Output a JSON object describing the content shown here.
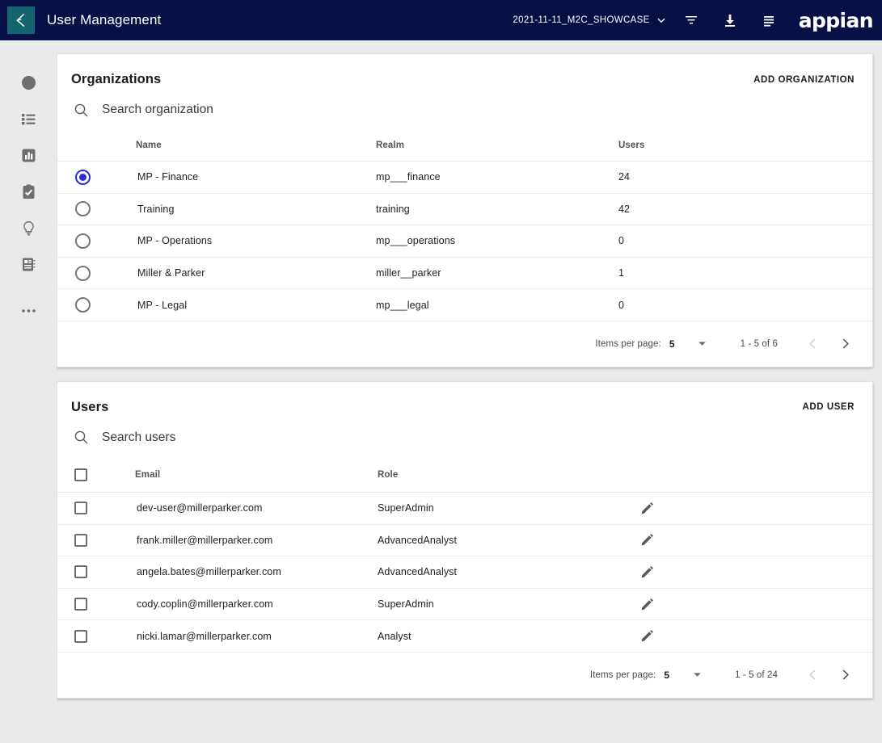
{
  "topbar": {
    "logo_icon": "appian-k-logo-icon",
    "app_title": "User Management",
    "environment": "2021-11-11_M2C_SHOWCASE",
    "chevron_icon": "chevron-down-icon",
    "filter_icon": "filter-icon",
    "download_icon": "download-icon",
    "menu_icon": "menu-list-icon",
    "brand": "appian",
    "bg_color": "#061046",
    "logo_tile_color": "#156570"
  },
  "sidebar": {
    "items": [
      {
        "name": "sidebar-item-navigator",
        "icon": "compass-icon"
      },
      {
        "name": "sidebar-item-records",
        "icon": "list-icon"
      },
      {
        "name": "sidebar-item-reports",
        "icon": "bar-chart-icon"
      },
      {
        "name": "sidebar-item-tasks",
        "icon": "clipboard-check-icon"
      },
      {
        "name": "sidebar-item-actions",
        "icon": "lightbulb-icon"
      },
      {
        "name": "sidebar-item-directory",
        "icon": "address-book-icon"
      },
      {
        "name": "sidebar-item-more",
        "icon": "ellipsis-icon"
      }
    ]
  },
  "organizations": {
    "title": "Organizations",
    "add_label": "ADD ORGANIZATION",
    "search_placeholder": "Search organization",
    "search_value": "",
    "search_icon": "search-icon",
    "columns": [
      "",
      "Name",
      "Realm",
      "Users"
    ],
    "selected_index": 0,
    "rows": [
      {
        "name": "MP - Finance",
        "realm": "mp___finance",
        "users": "24",
        "selected": true
      },
      {
        "name": "Training",
        "realm": "training",
        "users": "42",
        "selected": false
      },
      {
        "name": "MP - Operations",
        "realm": "mp___operations",
        "users": "0",
        "selected": false
      },
      {
        "name": "Miller & Parker",
        "realm": "miller__parker",
        "users": "1",
        "selected": false
      },
      {
        "name": "MP - Legal",
        "realm": "mp___legal",
        "users": "0",
        "selected": false
      }
    ],
    "paginator": {
      "label": "Items per page:",
      "page_size": "5",
      "range": "1 - 5 of 6",
      "prev_icon": "chevron-left-icon",
      "next_icon": "chevron-right-icon",
      "prev_disabled": true,
      "next_disabled": false
    }
  },
  "users": {
    "title": "Users",
    "add_label": "ADD USER",
    "search_placeholder": "Search users",
    "search_value": "",
    "search_icon": "search-icon",
    "columns": [
      "",
      "Email",
      "Role",
      ""
    ],
    "select_all_checked": false,
    "rows": [
      {
        "email": "dev-user@millerparker.com",
        "role": "SuperAdmin",
        "checked": false,
        "edit_icon": "pencil-icon"
      },
      {
        "email": "frank.miller@millerparker.com",
        "role": "AdvancedAnalyst",
        "checked": false,
        "edit_icon": "pencil-icon"
      },
      {
        "email": "angela.bates@millerparker.com",
        "role": "AdvancedAnalyst",
        "checked": false,
        "edit_icon": "pencil-icon"
      },
      {
        "email": "cody.coplin@millerparker.com",
        "role": "SuperAdmin",
        "checked": false,
        "edit_icon": "pencil-icon"
      },
      {
        "email": "nicki.lamar@millerparker.com",
        "role": "Analyst",
        "checked": false,
        "edit_icon": "pencil-icon"
      }
    ],
    "paginator": {
      "label": "Items per page:",
      "page_size": "5",
      "range": "1 - 5 of 24",
      "prev_icon": "chevron-left-icon",
      "next_icon": "chevron-right-icon",
      "prev_disabled": true,
      "next_disabled": false
    }
  },
  "theme": {
    "page_bg": "#eaeaea",
    "card_bg": "#ffffff",
    "accent_blue": "#2b2bd8",
    "text_primary": "#1b1b1b",
    "text_muted": "#555555"
  }
}
